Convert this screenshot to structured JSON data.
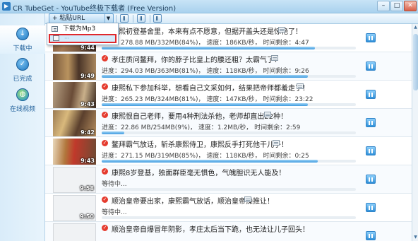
{
  "window": {
    "app_icon": "tubeget-logo",
    "title": "CR TubeGet - YouTube终极下载者 (Free Version)",
    "controls": [
      "minimize-icon",
      "maximize-icon",
      "close-icon"
    ]
  },
  "toolbar": {
    "paste_label": "+ 粘贴URL",
    "paste_arrow": "▼",
    "icons": [
      "pause-all-icon",
      "settings-icon",
      "pause-icon"
    ]
  },
  "dropdown": {
    "items": [
      {
        "label": "下载为Mp3",
        "icon": "document-icon"
      },
      {
        "label": "···",
        "icon": "document-icon",
        "highlighted": true
      }
    ]
  },
  "sidebar": {
    "items": [
      {
        "label": "下载中",
        "icon": "download-icon",
        "active": true
      },
      {
        "label": "已完成",
        "icon": "checkmark-icon",
        "active": false
      },
      {
        "label": "在线视频",
        "icon": "globe-icon",
        "active": false
      }
    ]
  },
  "downloads": [
    {
      "title": "康熙初登基舍里，本来有点不愿意，但据开盖头还是惊艳了！",
      "progress": "进度：278.88 MB/332MB(84%)",
      "speed": "速度：186KB/秒",
      "remaining": "时间剩余：4:47",
      "duration": "9:44",
      "progress_fraction": 0.84,
      "status": "downloading",
      "thumb": "video"
    },
    {
      "title": "孝庄质问鳌拜，你的脖子比皇上的腰还粗？太霸气了！",
      "progress": "进度：294.03 MB/363MB(81%)",
      "speed": "速度：118KB/秒",
      "remaining": "时间剩余：9:26",
      "duration": "9:49",
      "progress_fraction": 0.81,
      "status": "downloading",
      "thumb": "video"
    },
    {
      "title": "康熙私下参加科举，想看自己文采如何，结果把帝师都羞走了！",
      "progress": "进度：265.23 MB/324MB(81%)",
      "speed": "速度：147KB/秒",
      "remaining": "时间剩余：23:22",
      "duration": "9:43",
      "progress_fraction": 0.81,
      "status": "downloading",
      "thumb": "video"
    },
    {
      "title": "康熙恨自己老师，要用4种刑法杀他，老师却直出22种！",
      "progress": "进度：22.86 MB/254MB(9%)",
      "speed": "速度：1.2MB/秒",
      "remaining": "时间剩余：2:59",
      "duration": "9:42",
      "progress_fraction": 0.09,
      "status": "downloading",
      "thumb": "video"
    },
    {
      "title": "鳌拜霸气放话，斩杀康熙侍卫，康熙反手打死他干儿子！",
      "progress": "进度：271.15 MB/319MB(85%)",
      "speed": "速度：118KB/秒",
      "remaining": "时间剩余：0:25",
      "duration": "9:43",
      "progress_fraction": 0.85,
      "status": "downloading",
      "thumb": "video"
    },
    {
      "title": "康熙8岁登基，独面群臣毫无惧色，气魄胆识无人能及！",
      "progress": "等待中...",
      "speed": "",
      "remaining": "",
      "duration": "9:58",
      "progress_fraction": 0.0,
      "status": "waiting",
      "thumb": "placeholder"
    },
    {
      "title": "顺治皇帝要出家，康熙霸气放话，顺治皇帝操推让！",
      "progress": "等待中...",
      "speed": "",
      "remaining": "",
      "duration": "9:50",
      "progress_fraction": 0.0,
      "status": "waiting",
      "thumb": "placeholder"
    },
    {
      "title": "顺治皇帝自爆冒年阴影，孝庄太后当下跪，也无法让儿子回头！",
      "progress": "",
      "speed": "",
      "remaining": "",
      "duration": "",
      "progress_fraction": 0.0,
      "status": "waiting",
      "thumb": "placeholder"
    }
  ],
  "colors": {
    "accent": "#2f8fd8",
    "error_icon": "#e53b2e",
    "highlight_border": "#e0282c"
  }
}
